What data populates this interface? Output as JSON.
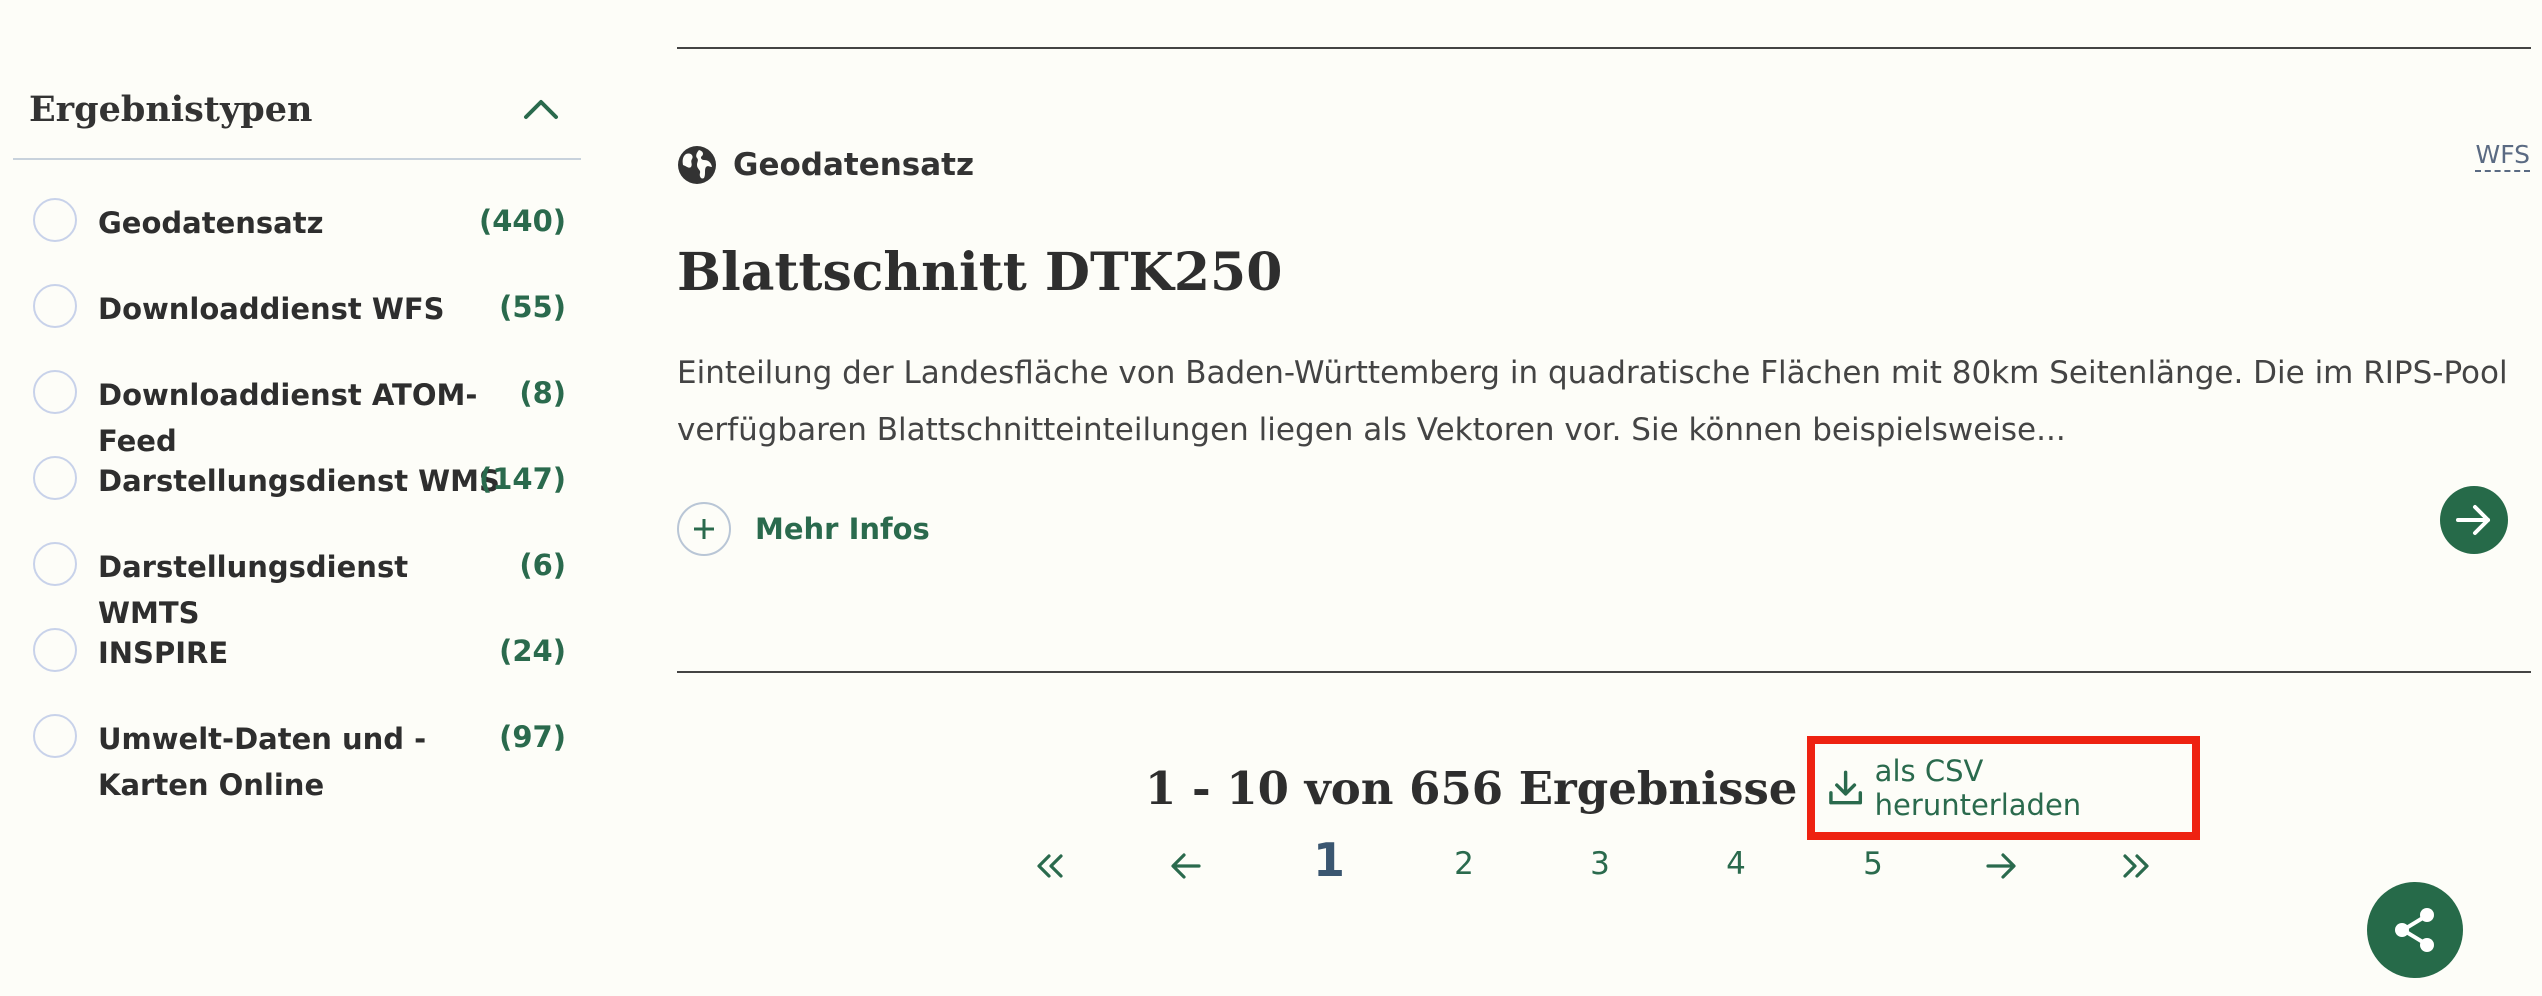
{
  "sidebar": {
    "title": "Ergebnistypen",
    "items": [
      {
        "label": "Geodatensatz",
        "count": "(440)"
      },
      {
        "label": "Downloaddienst WFS",
        "count": "(55)"
      },
      {
        "label": "Downloaddienst ATOM-Feed",
        "count": "(8)"
      },
      {
        "label": "Darstellungsdienst WMS",
        "count": "(147)"
      },
      {
        "label": "Darstellungsdienst WMTS",
        "count": "(6)"
      },
      {
        "label": "INSPIRE",
        "count": "(24)"
      },
      {
        "label": "Umwelt-Daten und -Karten Online",
        "count": "(97)"
      }
    ]
  },
  "result": {
    "type_label": "Geodatensatz",
    "service_tag": "WFS",
    "title": "Blattschnitt DTK250",
    "description": "Einteilung der Landesfläche von Baden-Württemberg in quadratische Flächen mit 80km Seitenlänge. Die im RIPS-Pool verfügbaren Blattschnitteinteilungen liegen als Vektoren vor. Sie können beispielsweise...",
    "more_info_label": "Mehr Infos"
  },
  "summary": {
    "text": "1 - 10 von 656 Ergebnisse",
    "csv_label": "als CSV herunterladen"
  },
  "pagination": {
    "current": "1",
    "pages": [
      "2",
      "3",
      "4",
      "5"
    ]
  },
  "colors": {
    "accent_green": "#266a49",
    "highlight_red": "#ee2211",
    "background": "#fdfdf8"
  },
  "icons": [
    "chevron-up-icon",
    "globe-icon",
    "plus-icon",
    "arrow-right-icon",
    "download-icon",
    "double-chevron-left-icon",
    "arrow-left-icon",
    "double-chevron-right-icon",
    "share-icon"
  ]
}
